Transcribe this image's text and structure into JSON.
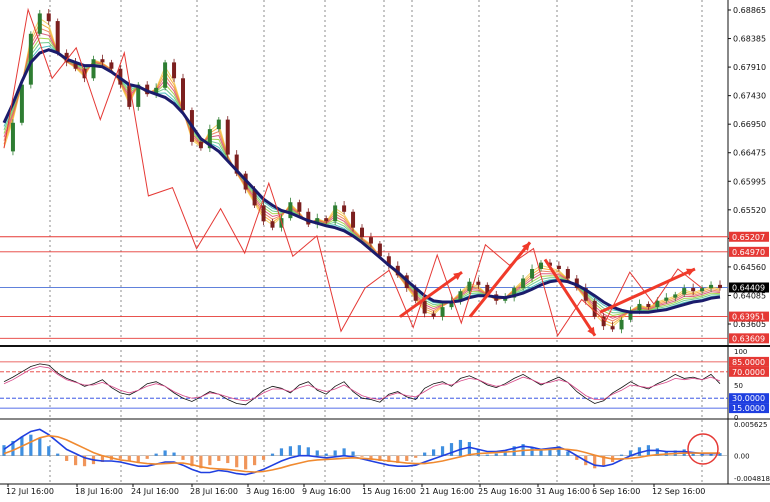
{
  "chart_data": [
    {
      "type": "line",
      "panel": "price",
      "ylim": [
        0.6352,
        0.689
      ],
      "y_ticks": [
        "0.68865",
        "0.68385",
        "0.67910",
        "0.67430",
        "0.66950",
        "0.66475",
        "0.65995",
        "0.65520",
        "0.65040",
        "0.64560",
        "0.64085",
        "0.63605"
      ],
      "series": [
        {
          "values": [
            0.6655,
            0.67,
            0.676,
            0.684,
            0.6872,
            0.686,
            0.681,
            0.6795,
            0.6785,
            0.677,
            0.68,
            0.6795,
            0.6785,
            0.676,
            0.6725,
            0.676,
            0.6745,
            0.6755,
            0.6795,
            0.677,
            0.672,
            0.667,
            0.666,
            0.669,
            0.6705,
            0.665,
            0.662,
            0.6595,
            0.657,
            0.6545,
            0.6535,
            0.655,
            0.6575,
            0.656,
            0.654,
            0.655,
            0.6545,
            0.657,
            0.656,
            0.6535,
            0.652,
            0.651,
            0.649,
            0.6475,
            0.646,
            0.644,
            0.642,
            0.64,
            0.6395,
            0.641,
            0.642,
            0.6435,
            0.645,
            0.6445,
            0.643,
            0.642,
            0.6425,
            0.644,
            0.6455,
            0.647,
            0.648,
            0.6475,
            0.647,
            0.6455,
            0.644,
            0.642,
            0.6395,
            0.638,
            0.6375,
            0.639,
            0.6405,
            0.6415,
            0.641,
            0.642,
            0.6425,
            0.643,
            0.644,
            0.6435,
            0.644,
            0.6445,
            0.644
          ]
        },
        {
          "values": [
            0.67,
            0.673,
            0.6765,
            0.6795,
            0.681,
            0.6815,
            0.681,
            0.68,
            0.6795,
            0.679,
            0.679,
            0.6788,
            0.678,
            0.677,
            0.676,
            0.6757,
            0.675,
            0.6745,
            0.674,
            0.673,
            0.6715,
            0.6695,
            0.6675,
            0.6665,
            0.6655,
            0.664,
            0.6625,
            0.661,
            0.6595,
            0.658,
            0.657,
            0.6562,
            0.6558,
            0.6552,
            0.6546,
            0.6542,
            0.6538,
            0.6535,
            0.653,
            0.6522,
            0.6512,
            0.65,
            0.6488,
            0.6476,
            0.6465,
            0.6452,
            0.644,
            0.6428,
            0.642,
            0.6418,
            0.6418,
            0.642,
            0.6425,
            0.6428,
            0.6428,
            0.6426,
            0.6425,
            0.6428,
            0.6432,
            0.6438,
            0.6445,
            0.645,
            0.6452,
            0.645,
            0.6445,
            0.6437,
            0.6428,
            0.6418,
            0.641,
            0.6405,
            0.6402,
            0.6402,
            0.6402,
            0.6404,
            0.6406,
            0.641,
            0.6414,
            0.6418,
            0.642,
            0.6424,
            0.6426
          ]
        }
      ],
      "zigzag": [
        0.666,
        0.6878,
        0.677,
        0.6818,
        0.6705,
        0.681,
        0.6585,
        0.6598,
        0.6502,
        0.6565,
        0.6495,
        0.6605,
        0.649,
        0.6522,
        0.6372,
        0.644,
        0.6468,
        0.6378,
        0.6492,
        0.6385,
        0.6508,
        0.6476,
        0.6502,
        0.6365,
        0.6422,
        0.6388,
        0.6465,
        0.6415,
        0.647,
        0.644
      ],
      "arrows": [
        [
          0.6395,
          0.6465
        ],
        [
          0.6395,
          0.6512
        ],
        [
          0.6485,
          0.6365
        ],
        [
          0.6402,
          0.647
        ]
      ],
      "levels": [
        {
          "value": 0.65207,
          "label": "0.65207",
          "color": "#e53935"
        },
        {
          "value": 0.6497,
          "label": "0.64970",
          "color": "#e53935"
        },
        {
          "value": 0.64409,
          "label": "0.64409",
          "color": "#4a6fd6"
        },
        {
          "value": 0.63951,
          "label": "0.63951",
          "color": "#e53935"
        },
        {
          "value": 0.63609,
          "label": "0.63609",
          "color": "#e53935"
        }
      ],
      "current_price": "0.64409"
    },
    {
      "type": "line",
      "panel": "oscillator",
      "ylim": [
        0,
        100
      ],
      "y_ticks": [
        "100",
        "50",
        "0"
      ],
      "series": [
        {
          "values": [
            55,
            62,
            70,
            78,
            82,
            80,
            68,
            60,
            55,
            48,
            52,
            58,
            46,
            38,
            35,
            42,
            52,
            55,
            48,
            38,
            30,
            25,
            32,
            40,
            36,
            28,
            22,
            20,
            30,
            42,
            48,
            45,
            38,
            50,
            55,
            42,
            36,
            48,
            55,
            40,
            30,
            28,
            24,
            36,
            40,
            32,
            28,
            45,
            52,
            55,
            48,
            60,
            64,
            58,
            50,
            46,
            52,
            60,
            66,
            58,
            50,
            56,
            62,
            54,
            40,
            30,
            22,
            26,
            38,
            46,
            55,
            48,
            44,
            52,
            58,
            66,
            60,
            62,
            58,
            66,
            52
          ]
        },
        {
          "values": [
            52,
            58,
            66,
            74,
            78,
            76,
            66,
            58,
            54,
            50,
            50,
            54,
            48,
            42,
            38,
            42,
            48,
            52,
            48,
            40,
            34,
            30,
            32,
            38,
            36,
            32,
            28,
            26,
            30,
            38,
            44,
            44,
            40,
            46,
            50,
            44,
            40,
            44,
            50,
            42,
            34,
            30,
            28,
            34,
            38,
            34,
            32,
            40,
            48,
            52,
            50,
            56,
            60,
            58,
            52,
            48,
            50,
            56,
            62,
            58,
            52,
            54,
            58,
            54,
            44,
            34,
            28,
            28,
            36,
            42,
            50,
            48,
            46,
            50,
            54,
            60,
            58,
            60,
            58,
            62,
            56
          ]
        }
      ],
      "levels": [
        {
          "value": 85,
          "label": "85.0000",
          "color": "#e53935"
        },
        {
          "value": 70,
          "label": "70.0000",
          "color": "#e53935"
        },
        {
          "value": 30,
          "label": "30.0000",
          "color": "#1f3fe0"
        },
        {
          "value": 15,
          "label": "15.0000",
          "color": "#1f3fe0"
        }
      ]
    },
    {
      "type": "bar",
      "panel": "macd",
      "ylim": [
        -0.005,
        0.0066
      ],
      "y_ticks": [
        "0.005625",
        "0.00",
        "-0.004818"
      ],
      "histogram": [
        0.002,
        0.0028,
        0.0036,
        0.004,
        0.0034,
        0.0018,
        0.0004,
        -0.001,
        -0.0018,
        -0.002,
        -0.0016,
        -0.0012,
        -0.0008,
        -0.0006,
        -0.001,
        -0.0014,
        -0.0006,
        0.0004,
        0.001,
        0.0006,
        -0.0008,
        -0.002,
        -0.0024,
        -0.0018,
        -0.001,
        -0.0014,
        -0.0022,
        -0.0026,
        -0.0018,
        -0.0008,
        0.0004,
        0.0014,
        0.0018,
        0.002,
        0.0016,
        0.001,
        0.0004,
        0.001,
        0.0014,
        0.0008,
        -0.0002,
        -0.0008,
        -0.001,
        -0.0012,
        -0.0014,
        -0.001,
        -0.0004,
        0.0006,
        0.0012,
        0.0018,
        0.0024,
        0.003,
        0.0026,
        0.0012,
        0.0002,
        0.0004,
        0.001,
        0.0018,
        0.0022,
        0.0016,
        0.001,
        0.0014,
        0.0018,
        0.0008,
        -0.0008,
        -0.0018,
        -0.0024,
        -0.002,
        -0.0012,
        0.0002,
        0.001,
        0.0016,
        0.002,
        0.0014,
        0.0008,
        0.001,
        0.0012,
        0.0006,
        0.0004,
        0.0006,
        0.0005
      ],
      "series": [
        {
          "values": [
            0.0012,
            0.0024,
            0.0036,
            0.0046,
            0.005,
            0.004,
            0.0026,
            0.0012,
            0.0004,
            -0.0004,
            -0.0008,
            -0.001,
            -0.001,
            -0.0012,
            -0.0016,
            -0.002,
            -0.002,
            -0.0016,
            -0.0012,
            -0.0012,
            -0.0018,
            -0.0026,
            -0.0032,
            -0.0032,
            -0.0028,
            -0.003,
            -0.0034,
            -0.0036,
            -0.0032,
            -0.0026,
            -0.0018,
            -0.001,
            -0.0004,
            0.0,
            0.0,
            -0.0002,
            -0.0004,
            -0.0002,
            0.0,
            -0.0002,
            -0.0006,
            -0.001,
            -0.0014,
            -0.0018,
            -0.002,
            -0.002,
            -0.0018,
            -0.0012,
            -0.0006,
            0.0,
            0.0006,
            0.0012,
            0.0016,
            0.0012,
            0.0008,
            0.0008,
            0.001,
            0.0014,
            0.0018,
            0.0016,
            0.0012,
            0.0014,
            0.0016,
            0.001,
            0.0,
            -0.001,
            -0.0018,
            -0.002,
            -0.0016,
            -0.0008,
            0.0,
            0.0006,
            0.001,
            0.001,
            0.0008,
            0.0008,
            0.0008,
            0.0006,
            0.0004,
            0.0004,
            0.0004
          ]
        },
        {
          "values": [
            0.0004,
            0.001,
            0.0018,
            0.0026,
            0.0034,
            0.0038,
            0.0036,
            0.003,
            0.0022,
            0.0014,
            0.0006,
            0.0,
            -0.0004,
            -0.0008,
            -0.001,
            -0.0013,
            -0.0015,
            -0.0016,
            -0.0015,
            -0.0014,
            -0.0014,
            -0.0017,
            -0.0021,
            -0.0024,
            -0.0025,
            -0.0026,
            -0.0028,
            -0.003,
            -0.0031,
            -0.003,
            -0.0027,
            -0.0023,
            -0.0018,
            -0.0014,
            -0.001,
            -0.0008,
            -0.0007,
            -0.0006,
            -0.0005,
            -0.0004,
            -0.0005,
            -0.0006,
            -0.0008,
            -0.001,
            -0.0012,
            -0.0014,
            -0.0015,
            -0.0015,
            -0.0013,
            -0.001,
            -0.0006,
            -0.0002,
            0.0002,
            0.0004,
            0.0005,
            0.0006,
            0.0007,
            0.0008,
            0.001,
            0.0011,
            0.0011,
            0.0012,
            0.0013,
            0.0012,
            0.001,
            0.0006,
            0.0001,
            -0.0003,
            -0.0006,
            -0.0006,
            -0.0005,
            -0.0003,
            0.0,
            0.0002,
            0.0003,
            0.0004,
            0.0005,
            0.0005,
            0.0005,
            0.0005,
            0.0005
          ]
        }
      ],
      "highlight_circle": true
    }
  ],
  "x_labels": [
    "12 Jul 16:00",
    "18 Jul 16:00",
    "24 Jul 16:00",
    "28 Jul 16:00",
    "3 Aug 16:00",
    "9 Aug 16:00",
    "15 Aug 16:00",
    "21 Aug 16:00",
    "25 Aug 16:00",
    "31 Aug 16:00",
    "6 Sep 16:00",
    "12 Sep 16:00"
  ],
  "colors": {
    "bull_candle": "#2e7d32",
    "bear_candle": "#7b1f1f",
    "ma_dark": "#1b1b6b",
    "zigzag": "#e53935",
    "arrow": "#f03a2a",
    "histo_pos": "#3f8fe0",
    "histo_neg": "#f0955a",
    "macd_line": "#1f3fe0",
    "signal_line": "#f08a30"
  }
}
